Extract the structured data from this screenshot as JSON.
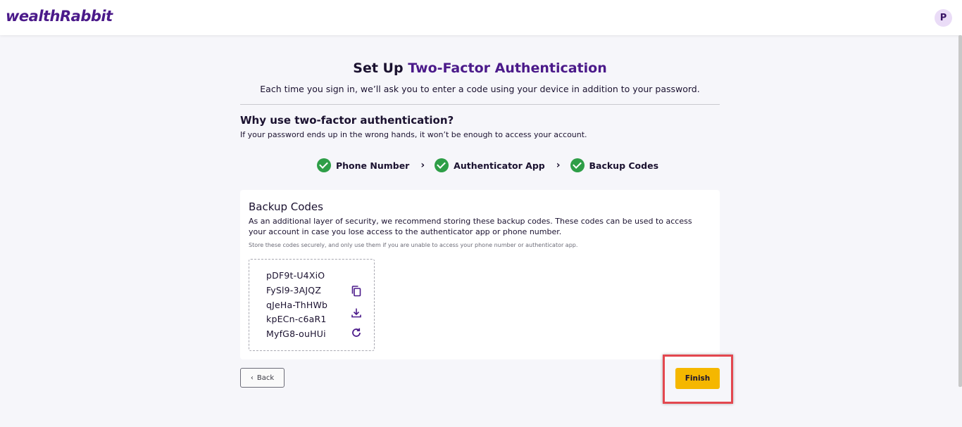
{
  "header": {
    "logo_part1": "wealth",
    "logo_part2": "Rabbit",
    "avatar_initial": "P"
  },
  "page": {
    "title_prefix": "Set Up ",
    "title_accent": "Two-Factor Authentication",
    "subtitle": "Each time you sign in, we’ll ask you to enter a code using your device in addition to your password.",
    "why_title": "Why use two-factor authentication?",
    "why_text": "If your password ends up in the wrong hands, it won’t be enough to access your account."
  },
  "steps": [
    {
      "label": "Phone Number",
      "status": "complete"
    },
    {
      "label": "Authenticator App",
      "status": "complete"
    },
    {
      "label": "Backup Codes",
      "status": "complete"
    }
  ],
  "backup": {
    "title": "Backup Codes",
    "description": "As an additional layer of security, we recommend storing these backup codes. These codes can be used to access your account in case you lose access to the authenticator app or phone number.",
    "note": "Store these codes securely, and only use them if you are unable to access your phone number or authenticator app.",
    "codes": [
      "pDF9t-U4XiO",
      "FySl9-3AJQZ",
      "qJeHa-ThHWb",
      "kpECn-c6aR1",
      "MyfG8-ouHUi"
    ],
    "icons": [
      "copy-icon",
      "download-icon",
      "refresh-icon"
    ]
  },
  "actions": {
    "back_label": "Back",
    "finish_label": "Finish"
  },
  "colors": {
    "brand_purple": "#4b1a8a",
    "accent_yellow": "#f5b700",
    "success_green": "#2e9e47",
    "highlight_red": "#e3474f"
  }
}
